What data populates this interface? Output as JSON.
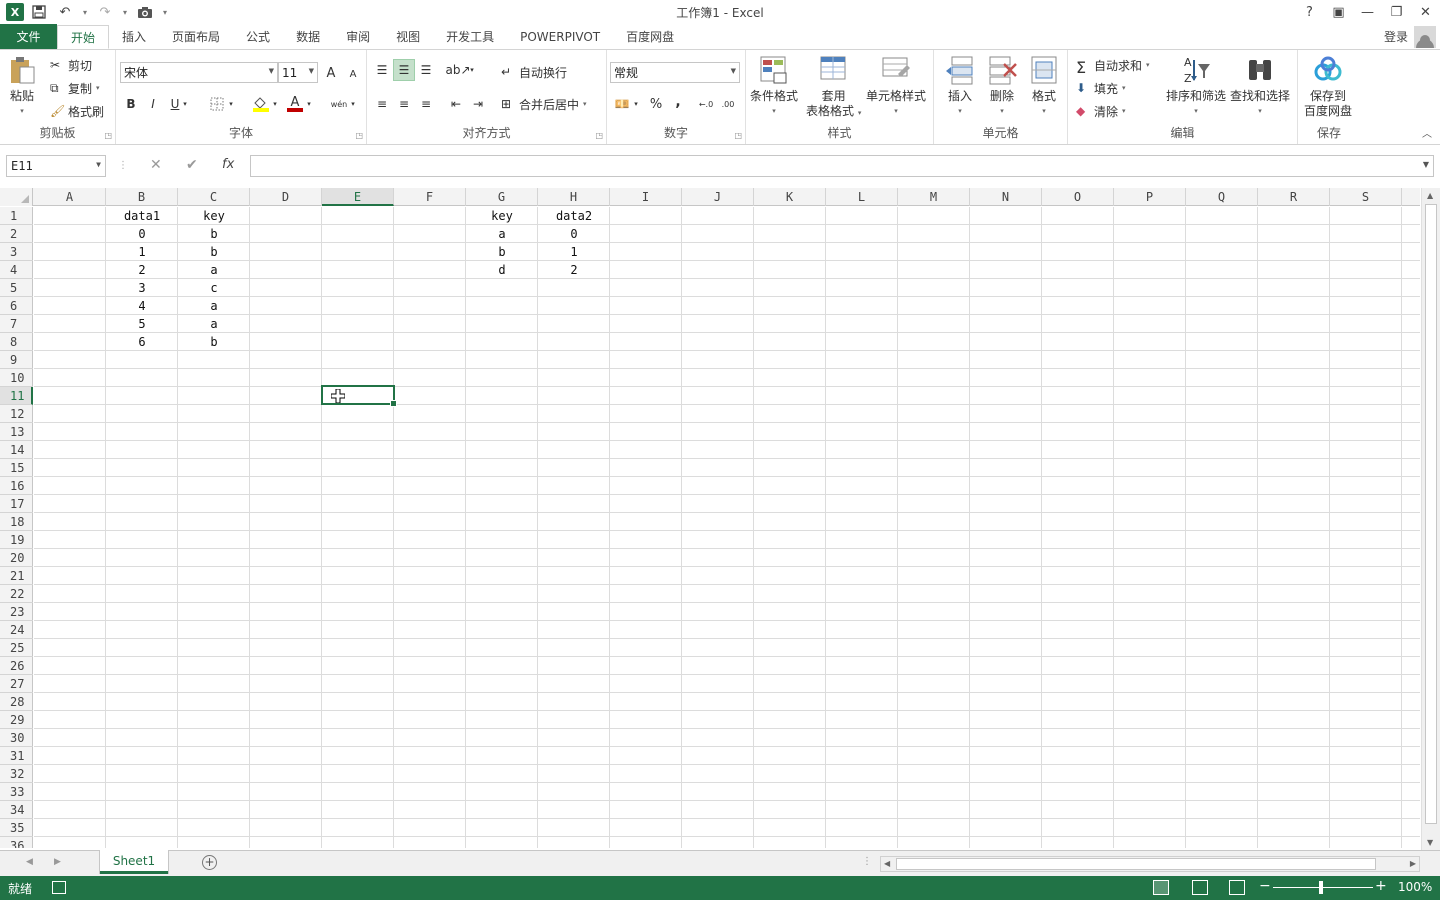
{
  "window": {
    "title": "工作簿1 - Excel",
    "app_icon": "X",
    "login": "登录",
    "help": "?",
    "ribbon_display": "▣",
    "minimize": "—",
    "restore": "❐",
    "close": "✕"
  },
  "tabs": [
    "文件",
    "开始",
    "插入",
    "页面布局",
    "公式",
    "数据",
    "审阅",
    "视图",
    "开发工具",
    "POWERPIVOT",
    "百度网盘"
  ],
  "active_tab": "开始",
  "ribbon": {
    "clipboard": {
      "label": "剪贴板",
      "paste": "粘贴",
      "cut": "剪切",
      "copy": "复制",
      "format_painter": "格式刷"
    },
    "font": {
      "label": "字体",
      "name": "宋体",
      "size": "11",
      "grow": "A",
      "shrink": "A",
      "bold": "B",
      "italic": "I",
      "underline": "U",
      "font_color": "A",
      "phonetic": "wén"
    },
    "alignment": {
      "label": "对齐方式",
      "wrap": "自动换行",
      "merge": "合并后居中"
    },
    "number": {
      "label": "数字",
      "format": "常规",
      "percent": "%",
      "comma": ",",
      "inc": "←.0",
      "dec": ".00"
    },
    "styles": {
      "label": "样式",
      "conditional": "条件格式",
      "table_1": "套用",
      "table_2": "表格格式",
      "cell_styles": "单元格样式"
    },
    "cells": {
      "label": "单元格",
      "insert": "插入",
      "delete": "删除",
      "format": "格式"
    },
    "editing": {
      "label": "编辑",
      "autosum": "自动求和",
      "fill": "填充",
      "clear": "清除",
      "sort": "排序和筛选",
      "find": "查找和选择"
    },
    "save": {
      "label": "保存",
      "save_1": "保存到",
      "save_2": "百度网盘"
    }
  },
  "formula_bar": {
    "name_box": "E11",
    "formula": "",
    "cancel": "✕",
    "enter": "✔",
    "fx": "fx"
  },
  "columns": [
    "A",
    "B",
    "C",
    "D",
    "E",
    "F",
    "G",
    "H",
    "I",
    "J",
    "K",
    "L",
    "M",
    "N",
    "O",
    "P",
    "Q",
    "R",
    "S"
  ],
  "selected_column": "E",
  "selected_row": 11,
  "row_count": 36,
  "cells": [
    {
      "col": 1,
      "row": 1,
      "v": "data1"
    },
    {
      "col": 2,
      "row": 1,
      "v": "key"
    },
    {
      "col": 1,
      "row": 2,
      "v": "0"
    },
    {
      "col": 2,
      "row": 2,
      "v": "b"
    },
    {
      "col": 1,
      "row": 3,
      "v": "1"
    },
    {
      "col": 2,
      "row": 3,
      "v": "b"
    },
    {
      "col": 1,
      "row": 4,
      "v": "2"
    },
    {
      "col": 2,
      "row": 4,
      "v": "a"
    },
    {
      "col": 1,
      "row": 5,
      "v": "3"
    },
    {
      "col": 2,
      "row": 5,
      "v": "c"
    },
    {
      "col": 1,
      "row": 6,
      "v": "4"
    },
    {
      "col": 2,
      "row": 6,
      "v": "a"
    },
    {
      "col": 1,
      "row": 7,
      "v": "5"
    },
    {
      "col": 2,
      "row": 7,
      "v": "a"
    },
    {
      "col": 1,
      "row": 8,
      "v": "6"
    },
    {
      "col": 2,
      "row": 8,
      "v": "b"
    },
    {
      "col": 6,
      "row": 1,
      "v": "key"
    },
    {
      "col": 7,
      "row": 1,
      "v": "data2"
    },
    {
      "col": 6,
      "row": 2,
      "v": "a"
    },
    {
      "col": 7,
      "row": 2,
      "v": "0"
    },
    {
      "col": 6,
      "row": 3,
      "v": "b"
    },
    {
      "col": 7,
      "row": 3,
      "v": "1"
    },
    {
      "col": 6,
      "row": 4,
      "v": "d"
    },
    {
      "col": 7,
      "row": 4,
      "v": "2"
    }
  ],
  "sheets": [
    "Sheet1"
  ],
  "status": {
    "ready": "就绪",
    "zoom": "100%",
    "zoom_minus": "−",
    "zoom_plus": "+"
  }
}
